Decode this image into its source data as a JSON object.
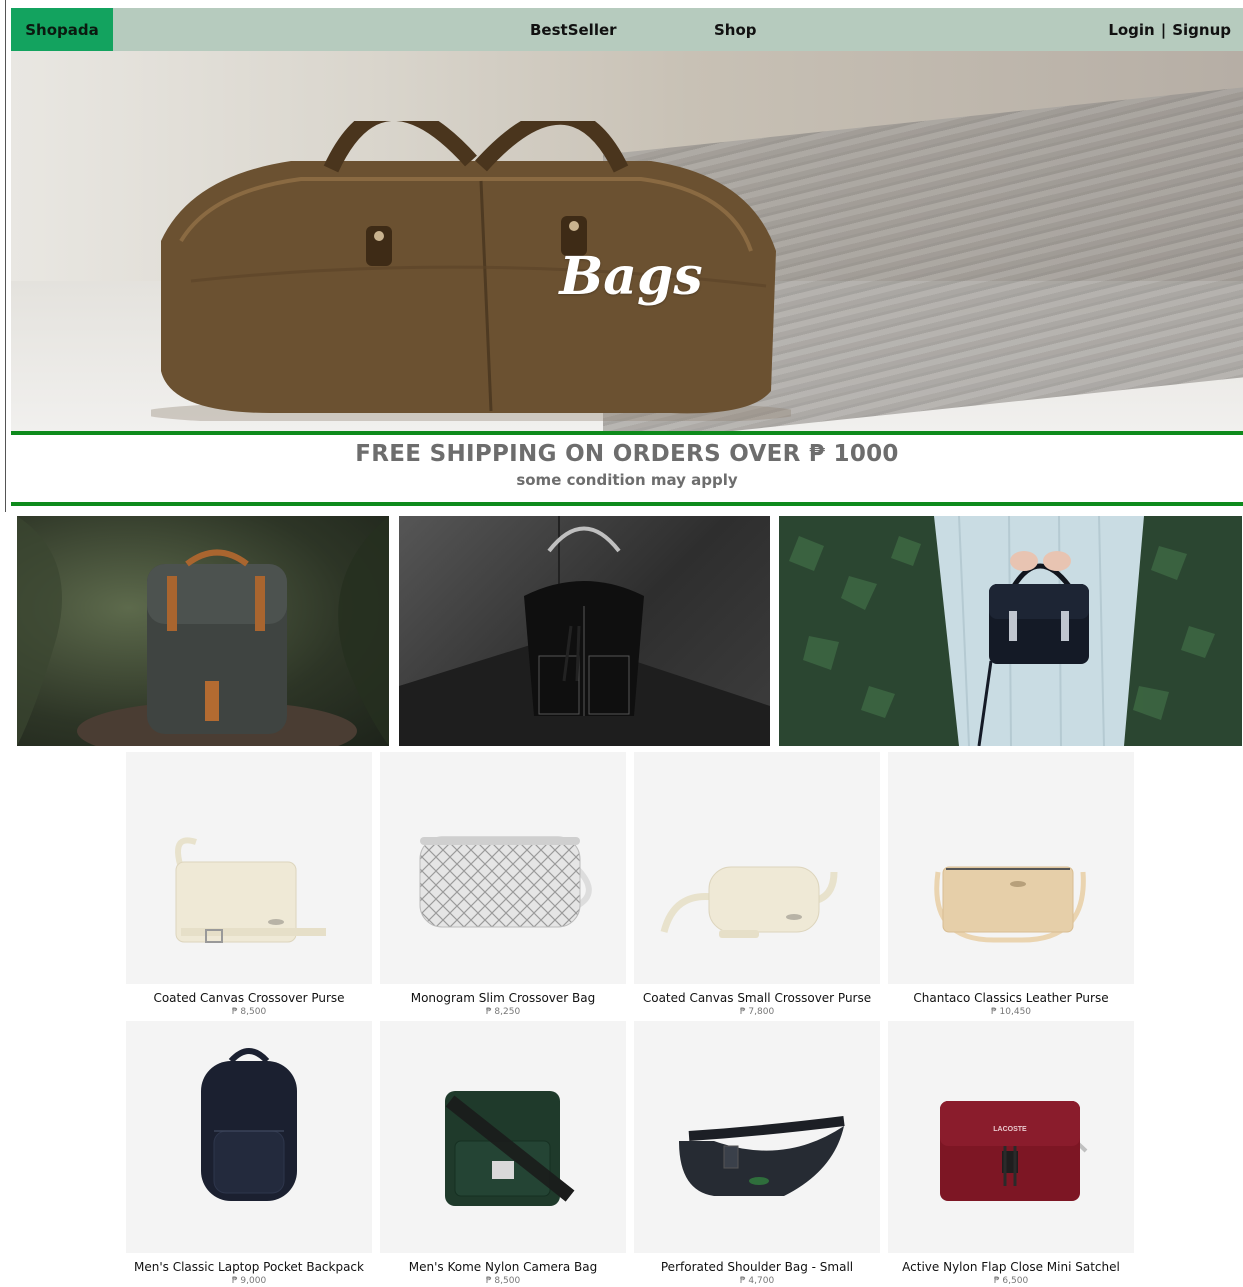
{
  "nav": {
    "brand": "Shopada",
    "bestseller": "BestSeller",
    "shop": "Shop",
    "login": "Login",
    "separator": "|",
    "signup": "Signup"
  },
  "hero": {
    "title": "Bags"
  },
  "shipping": {
    "title": "FREE SHIPPING ON ORDERS OVER ₱ 1000",
    "subtitle": "some condition may apply"
  },
  "features": [
    {
      "subject": "backpack-on-rock"
    },
    {
      "subject": "black-bucket-bag"
    },
    {
      "subject": "satchel-held-by-person"
    }
  ],
  "products": [
    {
      "name": "Coated Canvas Crossover Purse",
      "price": "₱ 8,500",
      "color": "#efe9d6"
    },
    {
      "name": "Monogram Slim Crossover Bag",
      "price": "₱ 8,250",
      "color": "#dcdcdc"
    },
    {
      "name": "Coated Canvas Small Crossover Purse",
      "price": "₱ 7,800",
      "color": "#efe9d6"
    },
    {
      "name": "Chantaco Classics Leather Purse",
      "price": "₱ 10,450",
      "color": "#e6cfa9"
    },
    {
      "name": "Men's Classic Laptop Pocket Backpack",
      "price": "₱ 9,000",
      "color": "#1b2030"
    },
    {
      "name": "Men's Kome Nylon Camera Bag",
      "price": "₱ 8,500",
      "color": "#1f3a2b"
    },
    {
      "name": "Perforated Shoulder Bag - Small",
      "price": "₱ 4,700",
      "color": "#262b33"
    },
    {
      "name": "Active Nylon Flap Close Mini Satchel",
      "price": "₱ 6,500",
      "color": "#7d1624"
    }
  ],
  "colors": {
    "navbar": "#b6cbbe",
    "brand": "#13a35f",
    "accent_line": "#0e8a1c",
    "shipping_text": "#6d6d6d"
  }
}
